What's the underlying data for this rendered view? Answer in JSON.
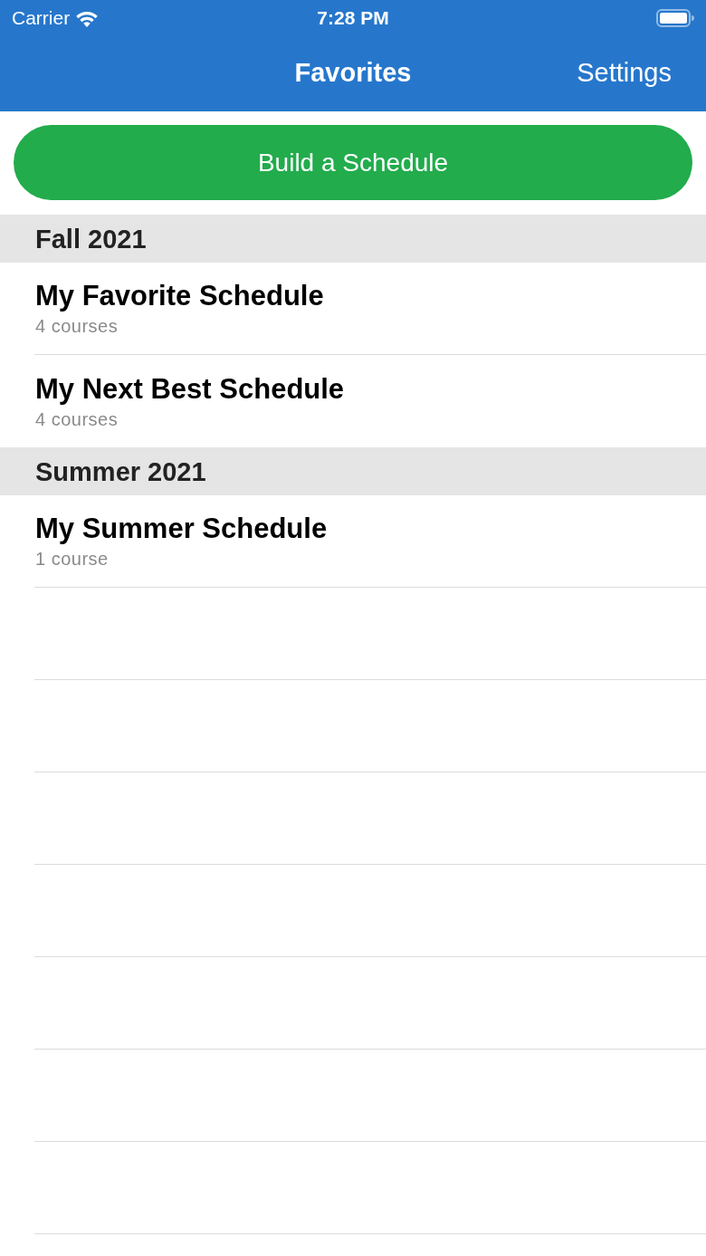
{
  "status_bar": {
    "carrier": "Carrier",
    "time": "7:28 PM"
  },
  "nav_bar": {
    "title": "Favorites",
    "right_button": "Settings"
  },
  "build_button": {
    "label": "Build a Schedule"
  },
  "sections": [
    {
      "title": "Fall 2021",
      "rows": [
        {
          "title": "My Favorite Schedule",
          "subtitle": "4 courses"
        },
        {
          "title": "My Next Best Schedule",
          "subtitle": "4 courses"
        }
      ]
    },
    {
      "title": "Summer 2021",
      "rows": [
        {
          "title": "My Summer Schedule",
          "subtitle": "1 course"
        }
      ]
    }
  ]
}
